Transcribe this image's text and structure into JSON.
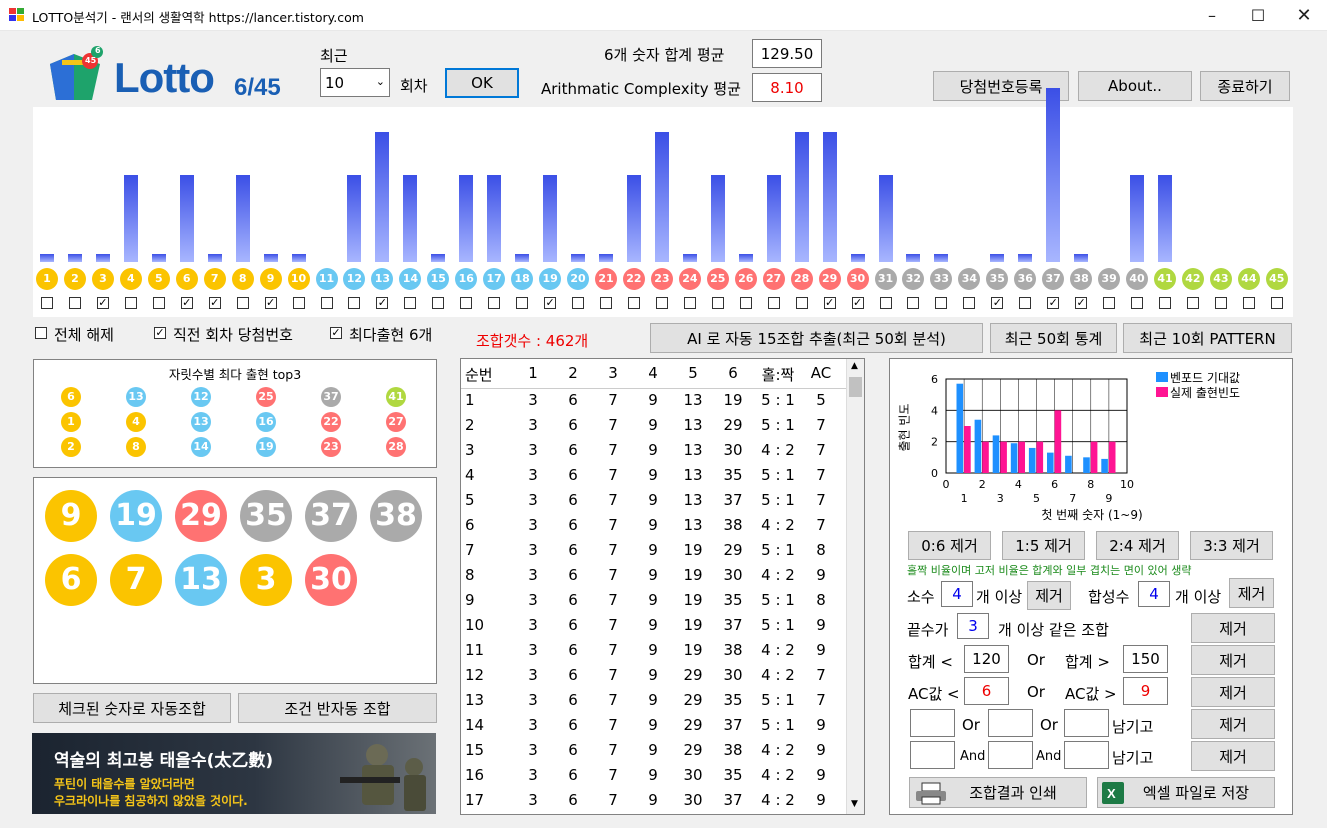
{
  "window": {
    "title": "LOTTO분석기  -  랜서의 생활역학 https://lancer.tistory.com"
  },
  "header": {
    "logo_text": "Lotto",
    "logo_sub": "6/45",
    "logo_badge_a": "45",
    "logo_badge_b": "6",
    "recent_label": "최근",
    "recent_value": "10",
    "round_label": "회차",
    "ok_button": "OK",
    "sum_avg_label": "6개 숫자 합계 평균",
    "sum_avg_value": "129.50",
    "ac_avg_label": "Arithmatic Complexity 평균",
    "ac_avg_value": "8.10",
    "register_button": "당첨번호등록",
    "about_button": "About..",
    "exit_button": "종료하기"
  },
  "frequency_chart": {
    "counts": [
      1,
      1,
      1,
      2,
      1,
      2,
      1,
      2,
      1,
      1,
      0,
      2,
      3,
      2,
      1,
      2,
      2,
      1,
      2,
      1,
      1,
      2,
      3,
      1,
      2,
      1,
      2,
      3,
      3,
      1,
      2,
      1,
      1,
      0,
      1,
      1,
      4,
      1,
      0,
      2,
      2,
      0,
      0,
      0,
      0
    ],
    "checked": [
      false,
      false,
      true,
      false,
      false,
      true,
      true,
      false,
      true,
      false,
      false,
      false,
      true,
      false,
      false,
      false,
      false,
      false,
      true,
      false,
      false,
      false,
      false,
      false,
      false,
      false,
      false,
      false,
      true,
      true,
      false,
      false,
      false,
      false,
      true,
      false,
      true,
      true,
      false,
      false,
      false,
      false,
      false,
      false,
      false
    ],
    "color_ranges": {
      "1-10": "#fbc400",
      "11-20": "#69c8f2",
      "21-30": "#ff7272",
      "31-40": "#aaaaaa",
      "41-45": "#b0d840"
    }
  },
  "options": {
    "clear_all": "전체 해제",
    "last_round": "직전 회차 당첨번호",
    "most_frequent": "최다출현 6개",
    "combo_count": "조합갯수 : 462개"
  },
  "actions": {
    "ai_button": "AI 로 자동 15조합 추출(최근 50회 분석)",
    "stats50_button": "최근 50회 통계",
    "pattern10_button": "최근 10회 PATTERN"
  },
  "top3": {
    "title": "자릿수별 최다 출현 top3",
    "rows": [
      [
        6,
        13,
        12,
        25,
        37,
        41
      ],
      [
        1,
        4,
        13,
        16,
        22,
        27
      ],
      [
        2,
        8,
        14,
        19,
        23,
        28
      ]
    ]
  },
  "selected_balls": [
    9,
    19,
    29,
    35,
    37,
    38,
    6,
    7,
    13,
    3,
    30
  ],
  "buttons_left": {
    "auto_combo": "체크된 숫자로 자동조합",
    "semi_auto": "조건 반자동 조합"
  },
  "ad": {
    "headline": "역술의 최고봉 태을수(太乙數)",
    "line1": "푸틴이 태을수를 알았더라면",
    "line2": "우크라이나를 침공하지 않았을 것이다."
  },
  "table": {
    "headers": [
      "순번",
      "1",
      "2",
      "3",
      "4",
      "5",
      "6",
      "홀:짝",
      "AC"
    ],
    "rows": [
      [
        "1",
        "3",
        "6",
        "7",
        "9",
        "13",
        "19",
        "5 : 1",
        "5"
      ],
      [
        "2",
        "3",
        "6",
        "7",
        "9",
        "13",
        "29",
        "5 : 1",
        "7"
      ],
      [
        "3",
        "3",
        "6",
        "7",
        "9",
        "13",
        "30",
        "4 : 2",
        "7"
      ],
      [
        "4",
        "3",
        "6",
        "7",
        "9",
        "13",
        "35",
        "5 : 1",
        "7"
      ],
      [
        "5",
        "3",
        "6",
        "7",
        "9",
        "13",
        "37",
        "5 : 1",
        "7"
      ],
      [
        "6",
        "3",
        "6",
        "7",
        "9",
        "13",
        "38",
        "4 : 2",
        "7"
      ],
      [
        "7",
        "3",
        "6",
        "7",
        "9",
        "19",
        "29",
        "5 : 1",
        "8"
      ],
      [
        "8",
        "3",
        "6",
        "7",
        "9",
        "19",
        "30",
        "4 : 2",
        "9"
      ],
      [
        "9",
        "3",
        "6",
        "7",
        "9",
        "19",
        "35",
        "5 : 1",
        "8"
      ],
      [
        "10",
        "3",
        "6",
        "7",
        "9",
        "19",
        "37",
        "5 : 1",
        "9"
      ],
      [
        "11",
        "3",
        "6",
        "7",
        "9",
        "19",
        "38",
        "4 : 2",
        "9"
      ],
      [
        "12",
        "3",
        "6",
        "7",
        "9",
        "29",
        "30",
        "4 : 2",
        "7"
      ],
      [
        "13",
        "3",
        "6",
        "7",
        "9",
        "29",
        "35",
        "5 : 1",
        "7"
      ],
      [
        "14",
        "3",
        "6",
        "7",
        "9",
        "29",
        "37",
        "5 : 1",
        "9"
      ],
      [
        "15",
        "3",
        "6",
        "7",
        "9",
        "29",
        "38",
        "4 : 2",
        "9"
      ],
      [
        "16",
        "3",
        "6",
        "7",
        "9",
        "30",
        "35",
        "4 : 2",
        "9"
      ],
      [
        "17",
        "3",
        "6",
        "7",
        "9",
        "30",
        "37",
        "4 : 2",
        "9"
      ]
    ]
  },
  "chart_data": {
    "type": "bar",
    "categories": [
      "1",
      "2",
      "3",
      "4",
      "5",
      "6",
      "7",
      "8",
      "9"
    ],
    "series": [
      {
        "name": "벤포드 기대값",
        "values": [
          5.7,
          3.4,
          2.4,
          1.9,
          1.6,
          1.3,
          1.1,
          1.0,
          0.9
        ],
        "color": "#1e90ff"
      },
      {
        "name": "실제 출현빈도",
        "values": [
          3,
          2,
          2,
          2,
          2,
          4,
          0,
          2,
          2
        ],
        "color": "#ff1493"
      }
    ],
    "xlabel": "첫 번째 숫자 (1~9)",
    "ylabel": "출현 빈도",
    "ylim": [
      0,
      6
    ],
    "xlim": [
      0,
      10
    ],
    "yticks": [
      "0",
      "2",
      "4",
      "6"
    ],
    "xticks_top": [
      "0",
      "2",
      "4",
      "6",
      "8",
      "10"
    ],
    "xticks_bottom": [
      "1",
      "3",
      "5",
      "7",
      "9"
    ],
    "legend": "top-right"
  },
  "filters": {
    "btn_06": "0:6 제거",
    "btn_15": "1:5 제거",
    "btn_24": "2:4 제거",
    "btn_33": "3:3 제거",
    "note": "홀짝 비율이며 고저 비율은 합계와 일부 겹치는 면이 있어 생략",
    "prime_label": "소수",
    "prime_value": "4",
    "prime_suffix": "개 이상",
    "composite_label": "합성수",
    "composite_value": "4",
    "composite_suffix": "개 이상",
    "remove": "제거",
    "lastdigit_label": "끝수가",
    "lastdigit_value": "3",
    "lastdigit_suffix": "개 이상 같은 조합",
    "sum_lt_label": "합계 <",
    "sum_lt_value": "120",
    "or": "Or",
    "sum_gt_label": "합계 >",
    "sum_gt_value": "150",
    "ac_lt_label": "AC값 <",
    "ac_lt_value": "6",
    "ac_gt_label": "AC값 >",
    "ac_gt_value": "9",
    "and": "And",
    "keep": "남기고",
    "print_button": "조합결과 인쇄",
    "excel_button": "엑셀 파일로 저장"
  }
}
